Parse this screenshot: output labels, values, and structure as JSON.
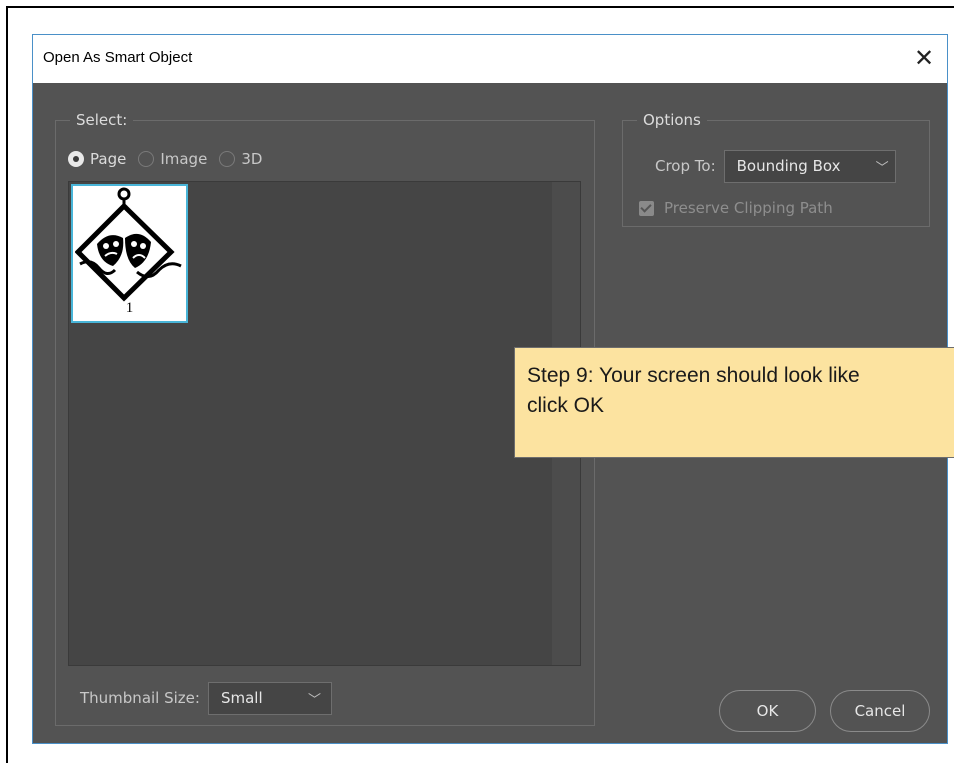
{
  "dialog": {
    "title": "Open As Smart Object",
    "close_icon": "close-icon"
  },
  "select": {
    "legend": "Select:",
    "radios": [
      {
        "label": "Page",
        "selected": true
      },
      {
        "label": "Image",
        "selected": false
      },
      {
        "label": "3D",
        "selected": false
      }
    ],
    "thumbnails": [
      {
        "page_number": "1",
        "selected": true,
        "icon": "theater-masks-icon"
      }
    ],
    "thumbnail_size_label": "Thumbnail Size:",
    "thumbnail_size_value": "Small"
  },
  "options": {
    "legend": "Options",
    "crop_to_label": "Crop To:",
    "crop_to_value": "Bounding Box",
    "preserve_clipping_path_label": "Preserve Clipping Path",
    "preserve_clipping_path_checked": true,
    "preserve_clipping_path_enabled": false
  },
  "buttons": {
    "ok": "OK",
    "cancel": "Cancel"
  },
  "callout": {
    "line1": "Step 9: Your screen should look like",
    "line2": "click OK"
  },
  "colors": {
    "dialog_bg": "#535353",
    "thumb_selection": "#49b5d8",
    "callout_bg": "#fce3a0"
  }
}
